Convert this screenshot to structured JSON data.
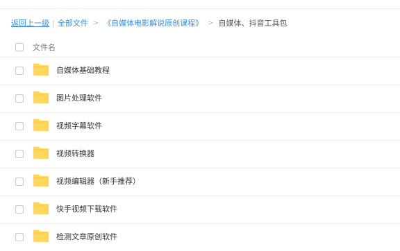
{
  "breadcrumb": {
    "back": "返回上一级",
    "divider": "|",
    "all_files": "全部文件",
    "separator": ">",
    "parent": "《自媒体电影解说原创课程》",
    "current": "自媒体、抖音工具包"
  },
  "file_list": {
    "header_label": "文件名",
    "folder_icon_color": "#ffd75e",
    "items": [
      {
        "name": "自媒体基础教程"
      },
      {
        "name": "图片处理软件"
      },
      {
        "name": "视频字幕软件"
      },
      {
        "name": "视频转换器"
      },
      {
        "name": "视频编辑器（新手推荐）"
      },
      {
        "name": "快手视频下载软件"
      },
      {
        "name": "检测文章原创软件"
      }
    ]
  },
  "colors": {
    "link": "#3a8ee6",
    "folder": "#ffd75e"
  }
}
